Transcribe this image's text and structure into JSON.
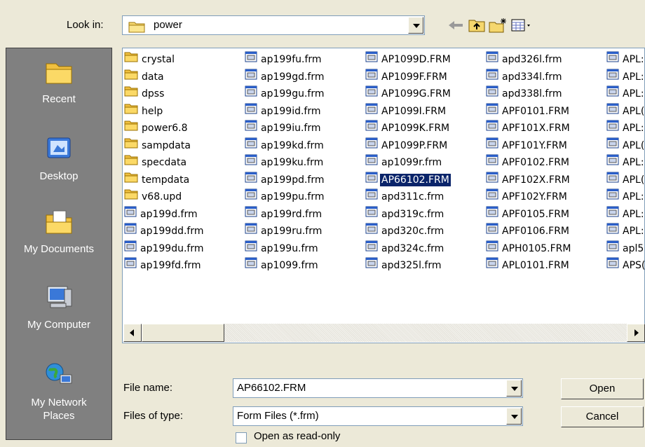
{
  "look_in": {
    "label": "Look in:",
    "value": "power"
  },
  "toolbar": {
    "back_icon": "back-arrow-icon",
    "up_icon": "up-folder-icon",
    "new_folder_icon": "new-folder-icon",
    "view_menu_icon": "view-menu-icon"
  },
  "places": [
    {
      "label": "Recent",
      "icon": "recent-folder-icon"
    },
    {
      "label": "Desktop",
      "icon": "desktop-icon"
    },
    {
      "label": "My Documents",
      "icon": "my-documents-icon"
    },
    {
      "label": "My Computer",
      "icon": "my-computer-icon"
    },
    {
      "label": "My Network Places",
      "icon": "network-places-icon"
    }
  ],
  "files": {
    "columns": [
      [
        {
          "name": "crystal",
          "type": "folder"
        },
        {
          "name": "data",
          "type": "folder"
        },
        {
          "name": "dpss",
          "type": "folder"
        },
        {
          "name": "help",
          "type": "folder"
        },
        {
          "name": "power6.8",
          "type": "folder"
        },
        {
          "name": "sampdata",
          "type": "folder"
        },
        {
          "name": "specdata",
          "type": "folder"
        },
        {
          "name": "tempdata",
          "type": "folder"
        },
        {
          "name": "v68.upd",
          "type": "folder"
        },
        {
          "name": "ap199d.frm",
          "type": "file"
        },
        {
          "name": "ap199dd.frm",
          "type": "file"
        },
        {
          "name": "ap199du.frm",
          "type": "file"
        },
        {
          "name": "ap199fd.frm",
          "type": "file"
        }
      ],
      [
        {
          "name": "ap199fu.frm",
          "type": "file"
        },
        {
          "name": "ap199gd.frm",
          "type": "file"
        },
        {
          "name": "ap199gu.frm",
          "type": "file"
        },
        {
          "name": "ap199id.frm",
          "type": "file"
        },
        {
          "name": "ap199iu.frm",
          "type": "file"
        },
        {
          "name": "ap199kd.frm",
          "type": "file"
        },
        {
          "name": "ap199ku.frm",
          "type": "file"
        },
        {
          "name": "ap199pd.frm",
          "type": "file"
        },
        {
          "name": "ap199pu.frm",
          "type": "file"
        },
        {
          "name": "ap199rd.frm",
          "type": "file"
        },
        {
          "name": "ap199ru.frm",
          "type": "file"
        },
        {
          "name": "ap199u.frm",
          "type": "file"
        },
        {
          "name": "ap1099.frm",
          "type": "file"
        }
      ],
      [
        {
          "name": "AP1099D.FRM",
          "type": "file"
        },
        {
          "name": "AP1099F.FRM",
          "type": "file"
        },
        {
          "name": "AP1099G.FRM",
          "type": "file"
        },
        {
          "name": "AP1099I.FRM",
          "type": "file"
        },
        {
          "name": "AP1099K.FRM",
          "type": "file"
        },
        {
          "name": "AP1099P.FRM",
          "type": "file"
        },
        {
          "name": "ap1099r.frm",
          "type": "file"
        },
        {
          "name": "AP66102.FRM",
          "type": "file",
          "selected": true
        },
        {
          "name": "apd311c.frm",
          "type": "file"
        },
        {
          "name": "apd319c.frm",
          "type": "file"
        },
        {
          "name": "apd320c.frm",
          "type": "file"
        },
        {
          "name": "apd324c.frm",
          "type": "file"
        },
        {
          "name": "apd325l.frm",
          "type": "file"
        }
      ],
      [
        {
          "name": "apd326l.frm",
          "type": "file"
        },
        {
          "name": "apd334l.frm",
          "type": "file"
        },
        {
          "name": "apd338l.frm",
          "type": "file"
        },
        {
          "name": "APF0101.FRM",
          "type": "file"
        },
        {
          "name": "APF101X.FRM",
          "type": "file"
        },
        {
          "name": "APF101Y.FRM",
          "type": "file"
        },
        {
          "name": "APF0102.FRM",
          "type": "file"
        },
        {
          "name": "APF102X.FRM",
          "type": "file"
        },
        {
          "name": "APF102Y.FRM",
          "type": "file"
        },
        {
          "name": "APF0105.FRM",
          "type": "file"
        },
        {
          "name": "APF0106.FRM",
          "type": "file"
        },
        {
          "name": "APH0105.FRM",
          "type": "file"
        },
        {
          "name": "APL0101.FRM",
          "type": "file"
        }
      ],
      [
        {
          "name": "APL:",
          "type": "file"
        },
        {
          "name": "APL:",
          "type": "file"
        },
        {
          "name": "APL:",
          "type": "file"
        },
        {
          "name": "APL(",
          "type": "file"
        },
        {
          "name": "APL:",
          "type": "file"
        },
        {
          "name": "APL(",
          "type": "file"
        },
        {
          "name": "APL:",
          "type": "file"
        },
        {
          "name": "APL(",
          "type": "file"
        },
        {
          "name": "APL:",
          "type": "file"
        },
        {
          "name": "APL:",
          "type": "file"
        },
        {
          "name": "APL:",
          "type": "file"
        },
        {
          "name": "apl5(",
          "type": "file"
        },
        {
          "name": "APS(",
          "type": "file"
        }
      ]
    ]
  },
  "file_name": {
    "label": "File name:",
    "value": "AP66102.FRM"
  },
  "file_type": {
    "label": "Files of type:",
    "value": "Form Files (*.frm)"
  },
  "read_only": {
    "label": "Open as read-only",
    "checked": false
  },
  "buttons": {
    "open": "Open",
    "cancel": "Cancel"
  }
}
